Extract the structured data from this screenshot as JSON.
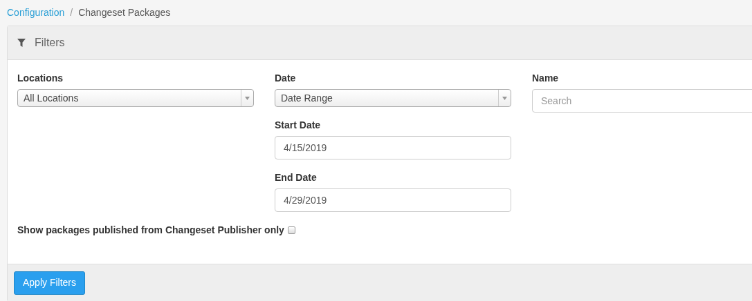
{
  "breadcrumb_separator": "/",
  "breadcrumb": [
    {
      "label": "Configuration",
      "kind": "link"
    },
    {
      "label": "Changeset Packages",
      "kind": "current"
    }
  ],
  "filters": {
    "title": "Filters",
    "locations": {
      "label": "Locations",
      "value": "All Locations"
    },
    "date": {
      "label": "Date",
      "value": "Date Range"
    },
    "start_date": {
      "label": "Start Date",
      "value": "4/15/2019"
    },
    "end_date": {
      "label": "End Date",
      "value": "4/29/2019"
    },
    "name": {
      "label": "Name",
      "placeholder": "Search"
    },
    "publisher_only": {
      "label": "Show packages published from Changeset Publisher only",
      "checked": false
    },
    "apply_button": "Apply Filters"
  }
}
